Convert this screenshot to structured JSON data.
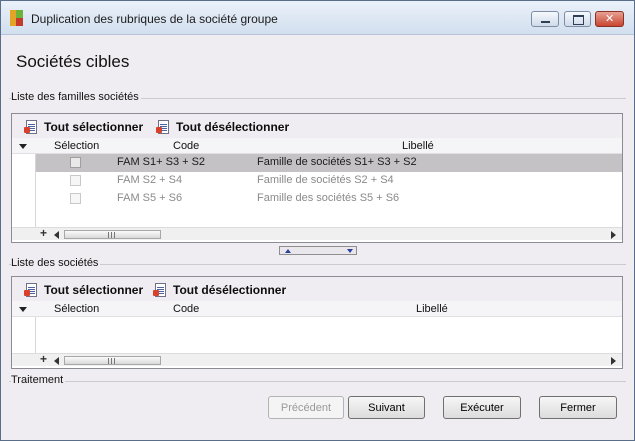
{
  "window": {
    "title": "Duplication des rubriques de la société groupe",
    "buttons": {
      "minimize": "minimize",
      "maximize": "maximize",
      "close": "close"
    }
  },
  "page_title": "Sociétés cibles",
  "families_section": {
    "label": "Liste des familles sociétés",
    "select_all": "Tout sélectionner",
    "deselect_all": "Tout désélectionner",
    "columns": {
      "selection": "Sélection",
      "code": "Code",
      "libelle": "Libellé"
    },
    "rows": [
      {
        "code": "FAM S1+ S3 + S2",
        "libelle": "Famille de sociétés  S1+ S3 + S2",
        "selected": true
      },
      {
        "code": "FAM S2 + S4",
        "libelle": "Famille de sociétés  S2 + S4",
        "selected": false
      },
      {
        "code": "FAM S5 + S6",
        "libelle": "Famille des sociétés S5 + S6",
        "selected": false
      }
    ],
    "add_symbol": "+"
  },
  "companies_section": {
    "label": "Liste des sociétés",
    "select_all": "Tout sélectionner",
    "deselect_all": "Tout désélectionner",
    "columns": {
      "selection": "Sélection",
      "code": "Code",
      "libelle": "Libellé"
    },
    "add_symbol": "+"
  },
  "treatment_section": {
    "label": "Traitement"
  },
  "actions": {
    "previous": "Précédent",
    "next": "Suivant",
    "execute": "Exécuter",
    "close": "Fermer"
  },
  "colors": {
    "selected_row": "#c4c2c5",
    "window_bg": "#f0edf2",
    "splitter_arrow": "#2a3fa0"
  }
}
